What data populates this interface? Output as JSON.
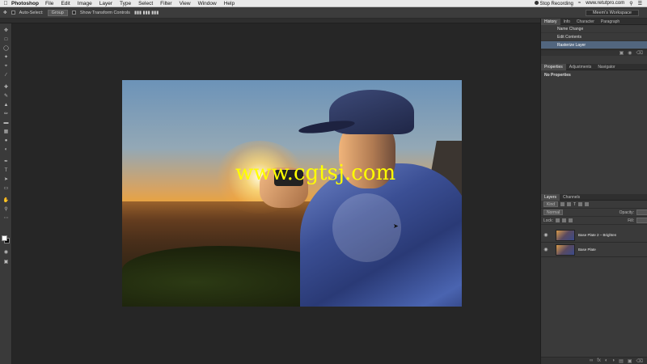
{
  "menubar": {
    "apple": "",
    "app_name": "Photoshop",
    "items": [
      "File",
      "Edit",
      "Image",
      "Layer",
      "Type",
      "Select",
      "Filter",
      "View",
      "Window",
      "Help"
    ],
    "recording": "Stop Recording",
    "website": "www.retutpro.com"
  },
  "options": {
    "auto_select_label": "Auto-Select:",
    "auto_select_value": "Group",
    "show_transform_label": "Show Transform Controls",
    "workspace": "Meem's Workspace"
  },
  "canvas": {
    "watermark": "www.cgtsj.com"
  },
  "history": {
    "tabs": [
      "History",
      "Info",
      "Character",
      "Paragraph"
    ],
    "items": [
      "Name Change",
      "Edit Contents",
      "Rasterize Layer"
    ]
  },
  "properties": {
    "tabs": [
      "Properties",
      "Adjustments",
      "Navigator"
    ],
    "empty_text": "No Properties"
  },
  "layers": {
    "tabs": [
      "Layers",
      "Channels"
    ],
    "filter_label": "Kind",
    "blend_mode": "Normal",
    "opacity_label": "Opacity:",
    "lock_label": "Lock:",
    "fill_label": "Fill:",
    "items": [
      {
        "name": "Base Plate 2 – Brighten"
      },
      {
        "name": "Base Plate"
      }
    ]
  },
  "colors": {
    "history_selected": "#52667f",
    "watermark": "#ffff00"
  }
}
